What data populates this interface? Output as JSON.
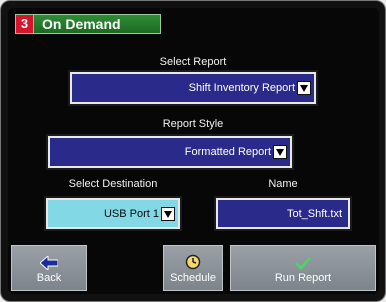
{
  "header": {
    "number": "3",
    "title": "On Demand"
  },
  "form": {
    "select_report_label": "Select Report",
    "select_report_value": "Shift Inventory Report",
    "report_style_label": "Report Style",
    "report_style_value": "Formatted Report",
    "destination_label": "Select Destination",
    "destination_value": "USB Port 1",
    "name_label": "Name",
    "name_value": "Tot_Shft.txt"
  },
  "buttons": {
    "back": "Back",
    "schedule": "Schedule",
    "run_report": "Run Report"
  },
  "colors": {
    "title_green": "#2f8d35",
    "badge_red": "#d5152a",
    "field_blue": "#2a2a8a",
    "field_cyan": "#83d8e6"
  }
}
